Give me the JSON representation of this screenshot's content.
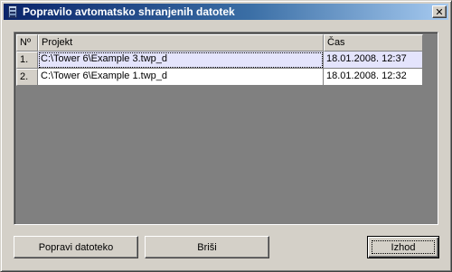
{
  "window": {
    "title": "Popravilo avtomatsko shranjenih datotek",
    "close_glyph": "✕"
  },
  "table": {
    "columns": [
      "Nº",
      "Projekt",
      "Čas"
    ],
    "rows": [
      {
        "no": "1.",
        "project": "C:\\Tower 6\\Example 3.twp_d",
        "time": "18.01.2008. 12:37",
        "selected": true
      },
      {
        "no": "2.",
        "project": "C:\\Tower 6\\Example 1.twp_d",
        "time": "18.01.2008. 12:32",
        "selected": false
      }
    ]
  },
  "buttons": {
    "repair": "Popravi datoteko",
    "delete": "Briši",
    "exit": "Izhod"
  },
  "colors": {
    "title_gradient_start": "#0a246a",
    "title_gradient_end": "#a6caf0",
    "selected_row": "#e4e4fc",
    "grid_background": "#808080"
  }
}
